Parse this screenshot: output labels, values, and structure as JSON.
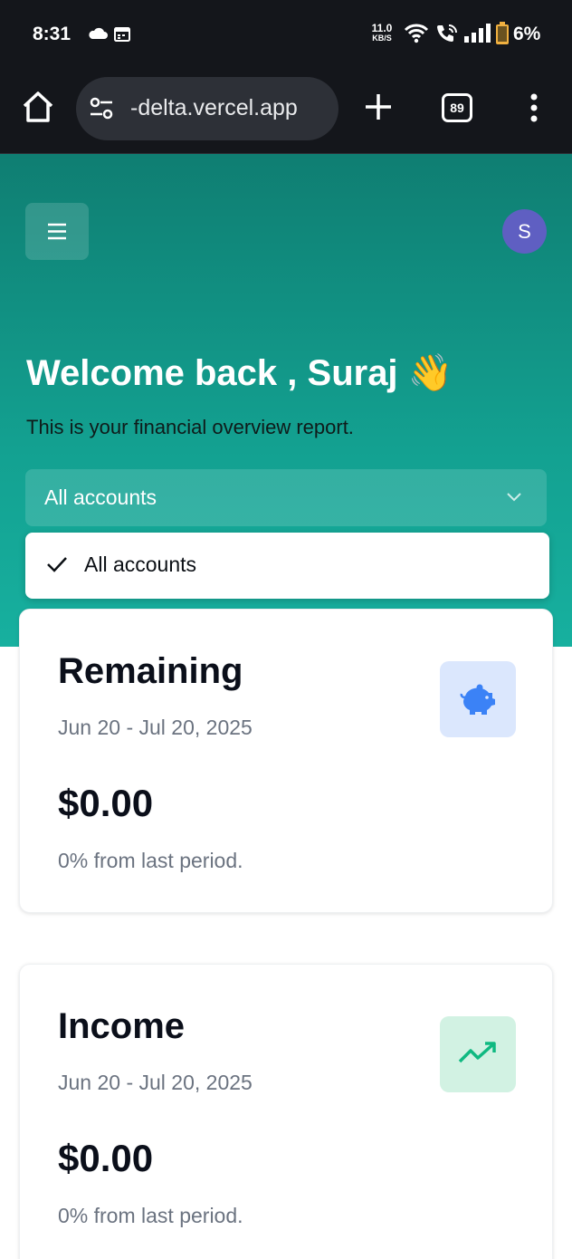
{
  "status_bar": {
    "time": "8:31",
    "net_speed_value": "11.0",
    "net_speed_unit": "KB/S",
    "battery": "6%",
    "icons": [
      "cloud-icon",
      "calendar-icon",
      "wifi-icon",
      "wifi-call-icon",
      "signal-icon",
      "battery-icon"
    ]
  },
  "browser": {
    "url": "-delta.vercel.app",
    "tab_count": "89",
    "icons": [
      "home-icon",
      "site-settings-icon",
      "plus-icon",
      "more-vert-icon"
    ]
  },
  "header": {
    "avatar_initial": "S",
    "welcome": "Welcome back , Suraj 👋",
    "subtitle": "This is your financial overview report.",
    "accent_color": "#13a191"
  },
  "account_select": {
    "value": "All accounts",
    "options": [
      "All accounts"
    ],
    "selected_option": "All accounts"
  },
  "cards": [
    {
      "title": "Remaining",
      "date_range": "Jun 20 - Jul 20, 2025",
      "amount": "$0.00",
      "change": "0% from last period.",
      "icon": "piggy-bank-icon",
      "icon_color": "#3b82f6"
    },
    {
      "title": "Income",
      "date_range": "Jun 20 - Jul 20, 2025",
      "amount": "$0.00",
      "change": "0% from last period.",
      "icon": "trending-up-icon",
      "icon_color": "#10b981"
    }
  ]
}
